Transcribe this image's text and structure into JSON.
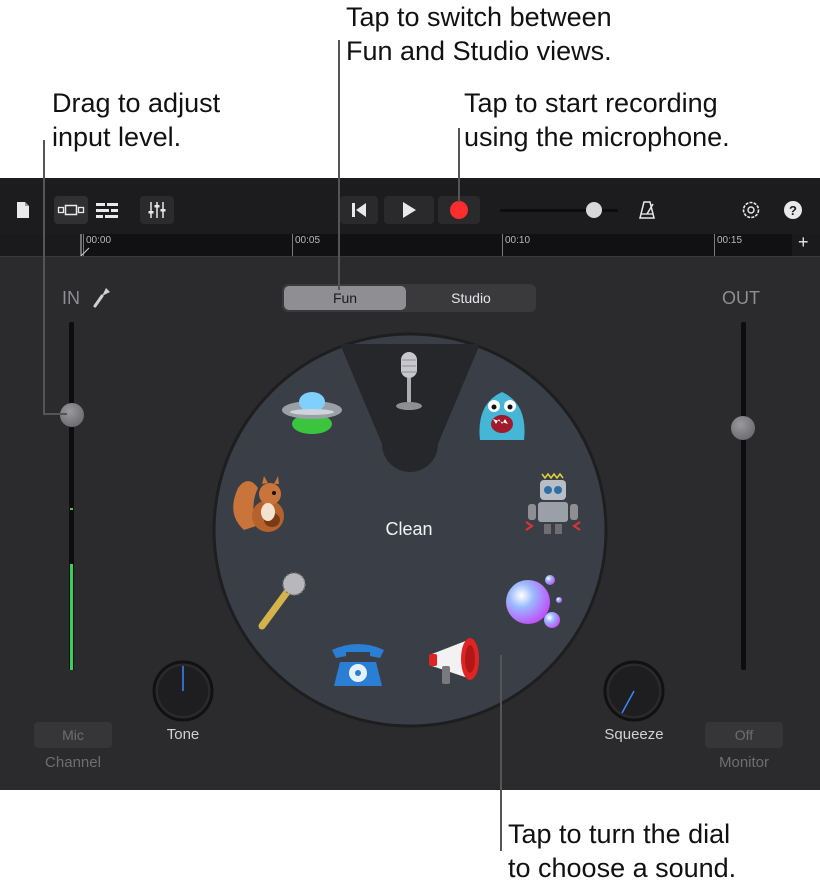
{
  "callouts": {
    "view_switch": "Tap to switch between\nFun and Studio views.",
    "input_level": "Drag to adjust\ninput level.",
    "record": "Tap to start recording\nusing the microphone.",
    "dial": "Tap to turn the dial\nto choose a sound."
  },
  "ruler": {
    "marks": [
      "00:00",
      "00:05",
      "00:10",
      "00:15"
    ],
    "add_label": "+"
  },
  "toolbar": {
    "help_label": "?"
  },
  "view_toggle": {
    "fun_label": "Fun",
    "studio_label": "Studio",
    "selected": "Fun"
  },
  "input": {
    "label": "IN",
    "level": 0.68
  },
  "output": {
    "label": "OUT",
    "level": 0.72
  },
  "dial": {
    "current_sound": "Clean"
  },
  "sounds": [
    "microphone",
    "ufo",
    "monster",
    "robot",
    "bubbles",
    "megaphone",
    "telephone",
    "handheld-mic",
    "squirrel"
  ],
  "knobs": {
    "tone_label": "Tone",
    "squeeze_label": "Squeeze"
  },
  "channel": {
    "button": "Mic",
    "label": "Channel"
  },
  "monitor": {
    "button": "Off",
    "label": "Monitor"
  },
  "colors": {
    "record": "#ff2d2d",
    "level_meter": "#37d158",
    "dial_bg": "#3a3f47",
    "app_bg": "#2b2b2d"
  }
}
